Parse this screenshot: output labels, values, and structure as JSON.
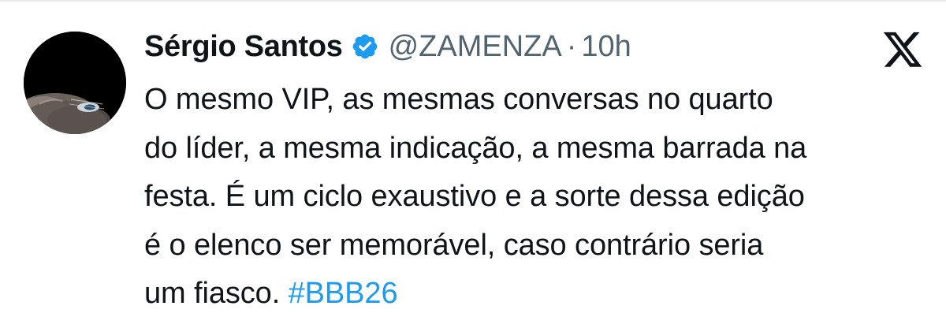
{
  "author": {
    "display_name": "Sérgio Santos",
    "handle": "@ZAMENZA",
    "separator": "·",
    "time": "10h",
    "verified": true
  },
  "tweet": {
    "lines": [
      "O mesmo VIP, as mesmas conversas no quarto",
      "do líder, a mesma indicação, a mesma barrada na",
      "festa. É um ciclo exaustivo e a sorte dessa edição",
      "é o elenco ser memorável, caso contrário seria",
      "um fiasco. "
    ],
    "hashtag": "#BBB26"
  },
  "icons": {
    "verified": "verified-badge-icon",
    "platform_logo": "x-logo-icon"
  },
  "colors": {
    "text": "#0f1419",
    "secondary_text": "#536471",
    "link": "#1d9bf0",
    "verified": "#1d9bf0"
  }
}
